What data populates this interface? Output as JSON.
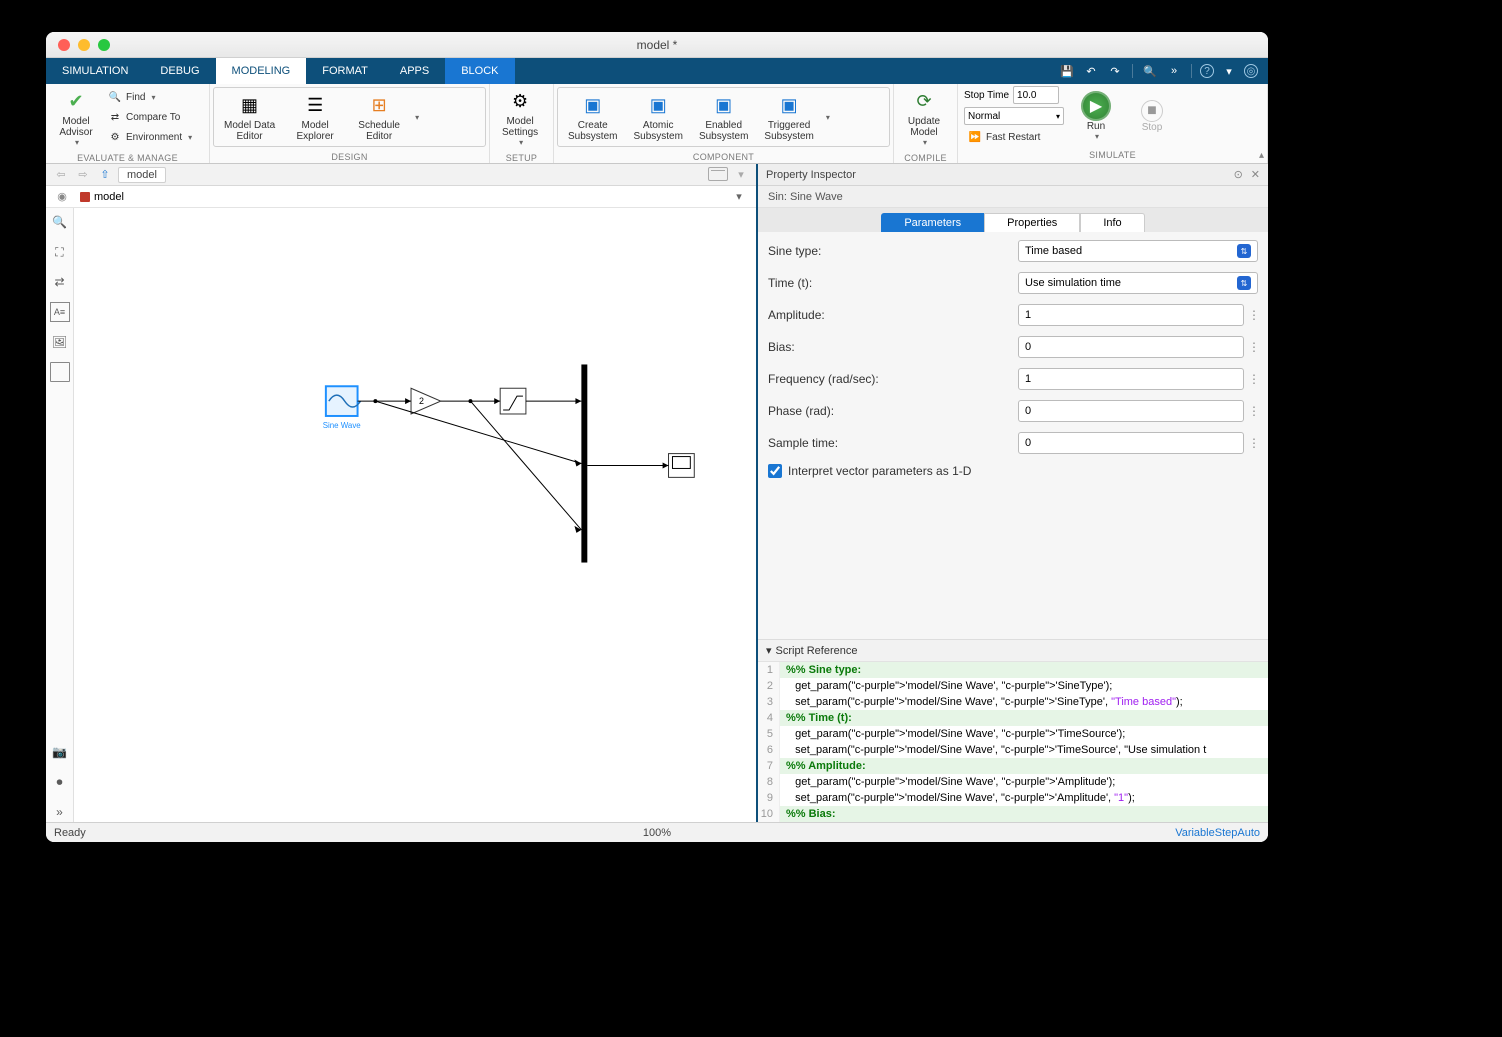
{
  "window_title": "model *",
  "tabs": [
    "SIMULATION",
    "DEBUG",
    "MODELING",
    "FORMAT",
    "APPS",
    "BLOCK"
  ],
  "active_tab": "MODELING",
  "ribbon": {
    "evaluate": {
      "model_advisor": "Model\nAdvisor",
      "find": "Find",
      "compare": "Compare To",
      "environment": "Environment",
      "label": "EVALUATE & MANAGE"
    },
    "design": {
      "model_data_editor": "Model Data\nEditor",
      "model_explorer": "Model\nExplorer",
      "schedule_editor": "Schedule\nEditor",
      "label": "DESIGN"
    },
    "setup": {
      "model_settings": "Model\nSettings",
      "label": "SETUP"
    },
    "component": {
      "create_subsystem": "Create\nSubsystem",
      "atomic_subsystem": "Atomic\nSubsystem",
      "enabled_subsystem": "Enabled\nSubsystem",
      "triggered_subsystem": "Triggered\nSubsystem",
      "label": "COMPONENT"
    },
    "compile": {
      "update_model": "Update\nModel",
      "label": "COMPILE"
    },
    "simulate": {
      "stop_time_label": "Stop Time",
      "stop_time_value": "10.0",
      "mode": "Normal",
      "fast_restart": "Fast Restart",
      "run": "Run",
      "stop": "Stop",
      "label": "SIMULATE"
    }
  },
  "breadcrumb": "model",
  "model_tab": "model",
  "canvas_blocks": {
    "sine_wave_label": "Sine Wave",
    "gain_value": "2"
  },
  "inspector": {
    "title": "Property Inspector",
    "subtitle": "Sin: Sine Wave",
    "tabs": [
      "Parameters",
      "Properties",
      "Info"
    ],
    "params": {
      "sine_type": {
        "label": "Sine type:",
        "value": "Time based"
      },
      "time": {
        "label": "Time (t):",
        "value": "Use simulation time"
      },
      "amplitude": {
        "label": "Amplitude:",
        "value": "1"
      },
      "bias": {
        "label": "Bias:",
        "value": "0"
      },
      "frequency": {
        "label": "Frequency (rad/sec):",
        "value": "1"
      },
      "phase": {
        "label": "Phase (rad):",
        "value": "0"
      },
      "sample_time": {
        "label": "Sample time:",
        "value": "0"
      },
      "interpret_1d": "Interpret vector parameters as 1-D"
    },
    "script_ref_title": "Script Reference",
    "code": [
      {
        "n": 1,
        "section": true,
        "txt": "%% Sine type: <SineType>"
      },
      {
        "n": 2,
        "txt": "   get_param('model/Sine Wave', 'SineType');"
      },
      {
        "n": 3,
        "txt": "   set_param('model/Sine Wave', 'SineType', \"Time based\");"
      },
      {
        "n": 4,
        "section": true,
        "txt": "%% Time (t): <TimeSource>"
      },
      {
        "n": 5,
        "txt": "   get_param('model/Sine Wave', 'TimeSource');"
      },
      {
        "n": 6,
        "txt": "   set_param('model/Sine Wave', 'TimeSource', \"Use simulation t"
      },
      {
        "n": 7,
        "section": true,
        "txt": "%% Amplitude: <Amplitude>"
      },
      {
        "n": 8,
        "txt": "   get_param('model/Sine Wave', 'Amplitude');"
      },
      {
        "n": 9,
        "txt": "   set_param('model/Sine Wave', 'Amplitude', \"1\");"
      },
      {
        "n": 10,
        "section": true,
        "txt": "%% Bias: <Bias>"
      }
    ]
  },
  "status": {
    "left": "Ready",
    "center": "100%",
    "right": "VariableStepAuto"
  }
}
